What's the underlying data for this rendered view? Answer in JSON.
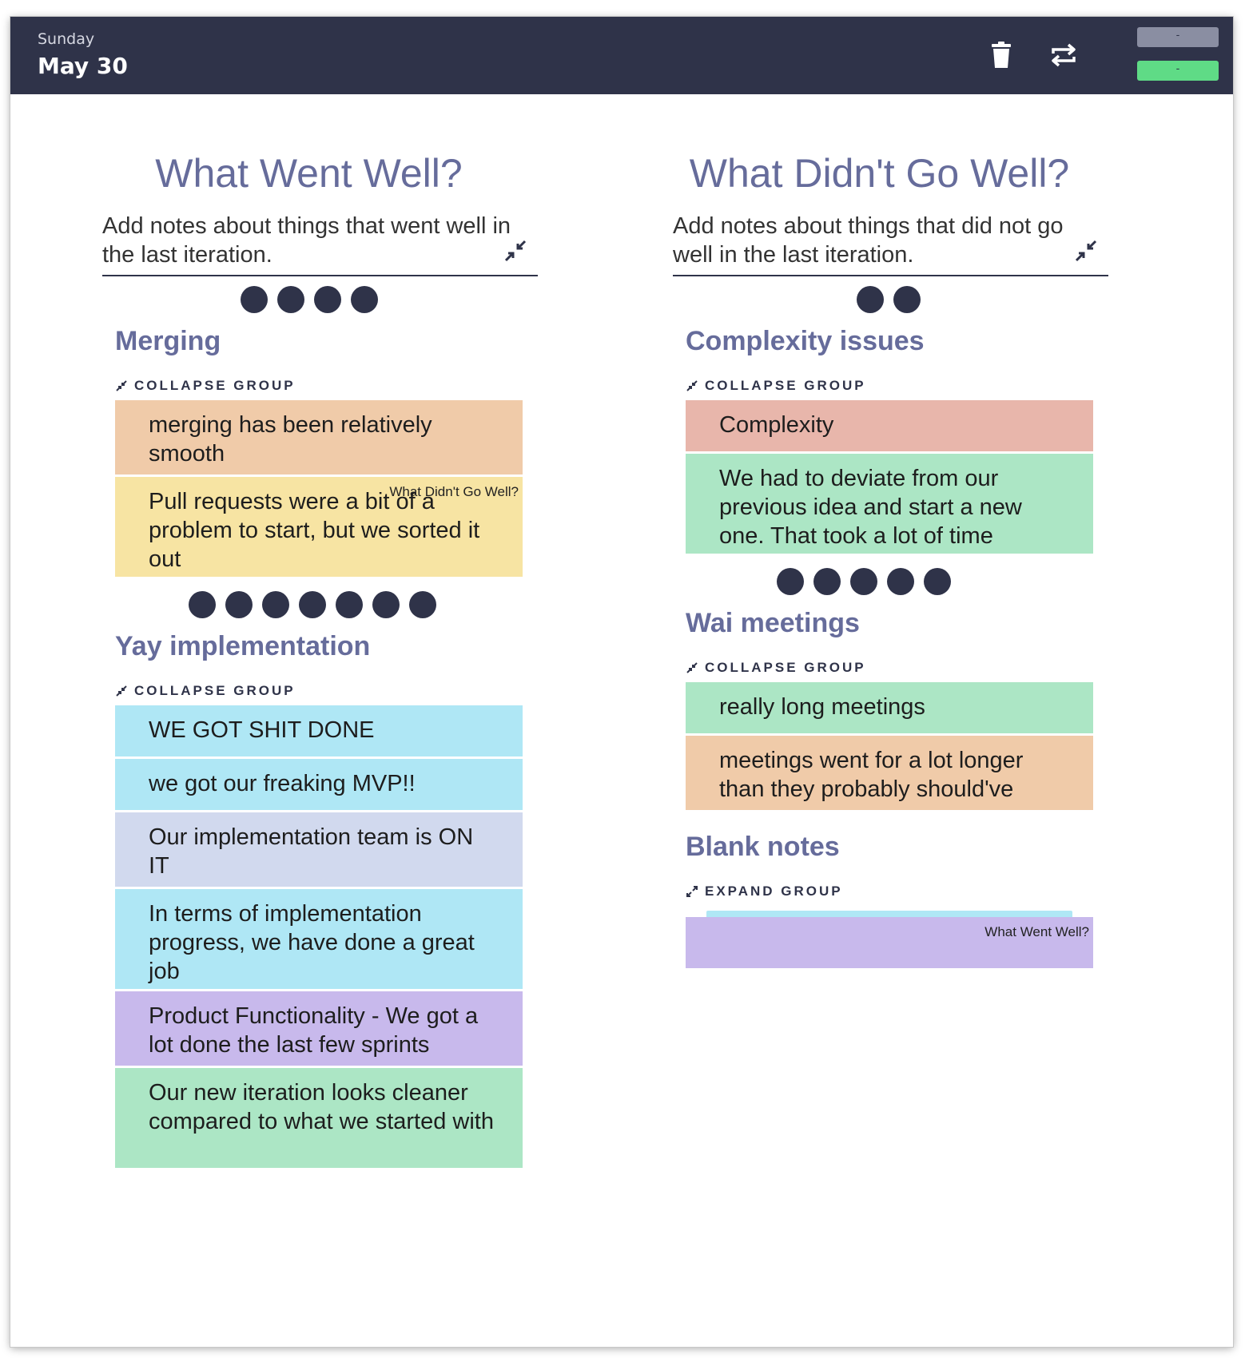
{
  "header": {
    "day": "Sunday",
    "date": "May 30",
    "icons": [
      "trash-icon",
      "swap-icon"
    ],
    "pill_gray_label": "-",
    "pill_green_label": "-",
    "colors": {
      "bar": "#2f3349",
      "pill_gray": "#8a8ea2",
      "pill_green": "#5fdb86"
    }
  },
  "columns": [
    {
      "title": "What Went Well?",
      "description": "Add notes about things that went well in the last iteration.",
      "top_votes": 4,
      "groups": [
        {
          "title": "Merging",
          "toggle": "COLLAPSE GROUP",
          "notes": [
            {
              "text": "merging has been relatively smooth",
              "color": "#f0cba9"
            },
            {
              "text": "Pull requests were a bit of a problem to start, but we sorted it out",
              "color": "#f7e4a3",
              "tag": "What Didn't Go Well?"
            }
          ],
          "votes_after": 7
        },
        {
          "title": "Yay implementation",
          "toggle": "COLLAPSE GROUP",
          "notes": [
            {
              "text": "WE GOT SHIT DONE",
              "color": "#afe7f5"
            },
            {
              "text": "we got our freaking MVP!!",
              "color": "#afe7f5"
            },
            {
              "text": "Our implementation team is ON IT",
              "color": "#d1d9ee"
            },
            {
              "text": "In terms of implementation progress, we have done a great job",
              "color": "#afe7f5"
            },
            {
              "text": "Product Functionality - We got a lot done the last few sprints",
              "color": "#c8b9ec"
            },
            {
              "text": "Our new iteration looks cleaner compared to what we started with",
              "color": "#ace6c5"
            }
          ]
        }
      ]
    },
    {
      "title": "What Didn't Go Well?",
      "description": "Add notes about things that did not go well in the last iteration.",
      "top_votes": 2,
      "groups": [
        {
          "title": "Complexity issues",
          "toggle": "COLLAPSE GROUP",
          "notes": [
            {
              "text": "Complexity",
              "color": "#e8b6ab"
            },
            {
              "text": "We had to deviate from our previous idea and start a new one. That took a lot of time",
              "color": "#ace6c5"
            }
          ],
          "votes_after": 5
        },
        {
          "title": "Wai meetings",
          "toggle": "COLLAPSE GROUP",
          "notes": [
            {
              "text": "really long meetings",
              "color": "#ace6c5"
            },
            {
              "text": "meetings went for a lot longer than they probably should've",
              "color": "#f0cba9"
            }
          ]
        },
        {
          "title": "Blank notes",
          "toggle": "EXPAND GROUP",
          "notes": [
            {
              "text": "",
              "color": "#c8b9ec",
              "tag": "What Went Well?",
              "stack_color": "#afe7f5"
            }
          ]
        }
      ]
    }
  ]
}
